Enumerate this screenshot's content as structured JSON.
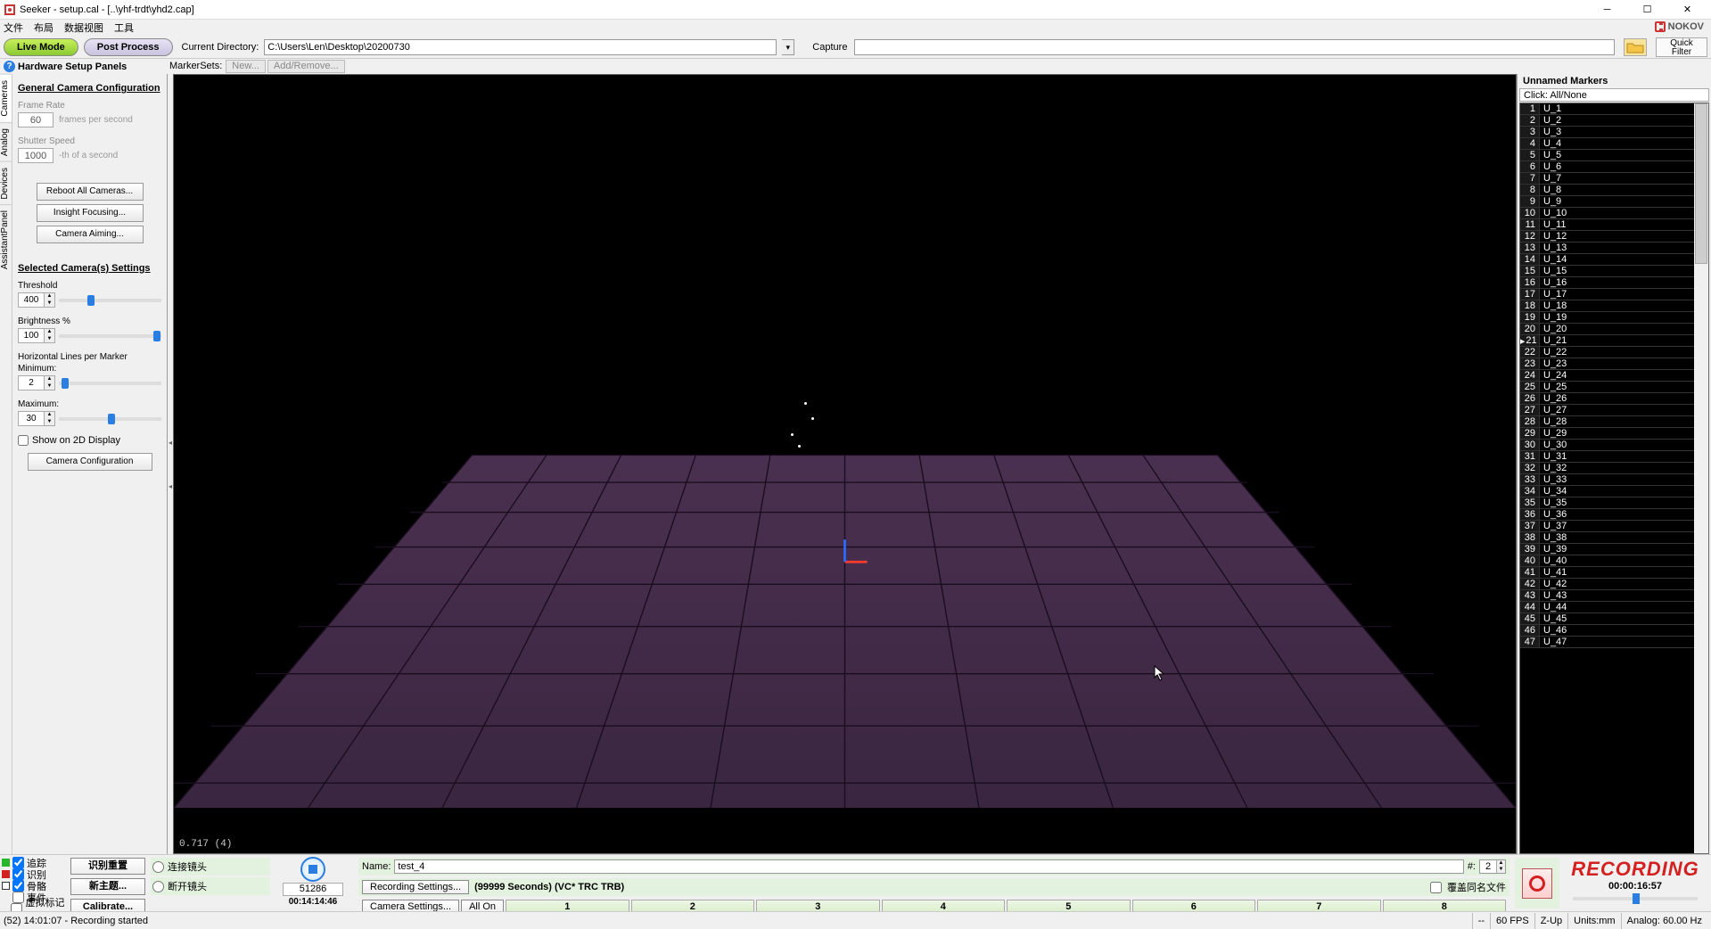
{
  "title": "Seeker  - setup.cal - [..\\yhf-trdt\\yhd2.cap]",
  "menus": [
    "文件",
    "布局",
    "数据视图",
    "工具"
  ],
  "toolbar": {
    "live": "Live Mode",
    "post": "Post Process",
    "dir_label": "Current Directory:",
    "dir_value": "C:\\Users\\Len\\Desktop\\20200730",
    "capture_label": "Capture",
    "quick": "Quick\nFilter"
  },
  "hw_header": "Hardware Setup Panels",
  "markersets": {
    "label": "MarkerSets:",
    "new": "New...",
    "addrem": "Add/Remove..."
  },
  "sidetabs": [
    "Cameras",
    "Analog",
    "Devices",
    "AssistantPanel"
  ],
  "panel": {
    "general_title": "General Camera Configuration",
    "frame_rate_label": "Frame Rate",
    "frame_rate": "60",
    "fps_suffix": "frames per second",
    "shutter_label": "Shutter Speed",
    "shutter": "1000",
    "shutter_suffix": "-th of a second",
    "reboot": "Reboot All Cameras...",
    "insight": "Insight Focusing...",
    "aiming": "Camera Aiming...",
    "selected_title": "Selected Camera(s) Settings",
    "threshold_label": "Threshold",
    "threshold": "400",
    "brightness_label": "Brightness %",
    "brightness": "100",
    "hlpm_label": "Horizontal Lines per Marker",
    "min_label": "Minimum:",
    "min": "2",
    "max_label": "Maximum:",
    "max": "30",
    "show2d": "Show on 2D Display",
    "camconf": "Camera Configuration"
  },
  "viewport": {
    "info": "0.717 (4)"
  },
  "right": {
    "title": "Unnamed Markers",
    "hint": "Click: All/None",
    "markers": [
      "U_1",
      "U_2",
      "U_3",
      "U_4",
      "U_5",
      "U_6",
      "U_7",
      "U_8",
      "U_9",
      "U_10",
      "U_11",
      "U_12",
      "U_13",
      "U_14",
      "U_15",
      "U_16",
      "U_17",
      "U_18",
      "U_19",
      "U_20",
      "U_21",
      "U_22",
      "U_23",
      "U_24",
      "U_25",
      "U_26",
      "U_27",
      "U_28",
      "U_29",
      "U_30",
      "U_31",
      "U_32",
      "U_33",
      "U_34",
      "U_35",
      "U_36",
      "U_37",
      "U_38",
      "U_39",
      "U_40",
      "U_41",
      "U_42",
      "U_43",
      "U_44",
      "U_45",
      "U_46",
      "U_47"
    ]
  },
  "bottom": {
    "checks": [
      "追踪",
      "识别",
      "骨骼",
      "事件",
      "虚拟标记点"
    ],
    "btn1": "识别重置",
    "btn2": "新主题...",
    "calibrate": "Calibrate...",
    "radio1": "连接镜头",
    "radio2": "断开镜头",
    "frames": "51286",
    "time": "00:14:14:46",
    "name_label": "Name:",
    "name_value": "test_4",
    "hash_label": "#:",
    "hash_value": "2",
    "recset": "Recording Settings...",
    "recinfo": "(99999 Seconds) (VC* TRC TRB)",
    "overwrite": "覆盖同名文件",
    "recording": "RECORDING",
    "rectime": "00:00:16:57"
  },
  "camstrip": {
    "settings": "Camera Settings...",
    "allon": "All On",
    "cams": [
      "1",
      "2",
      "3",
      "4",
      "5",
      "6",
      "7",
      "8"
    ]
  },
  "status": {
    "left": "(52) 14:01:07 - Recording started",
    "dash": "--",
    "fps": "60 FPS",
    "zup": "Z-Up",
    "units": "Units:mm",
    "analog": "Analog: 60.00 Hz"
  },
  "nokov": "NOKOV"
}
